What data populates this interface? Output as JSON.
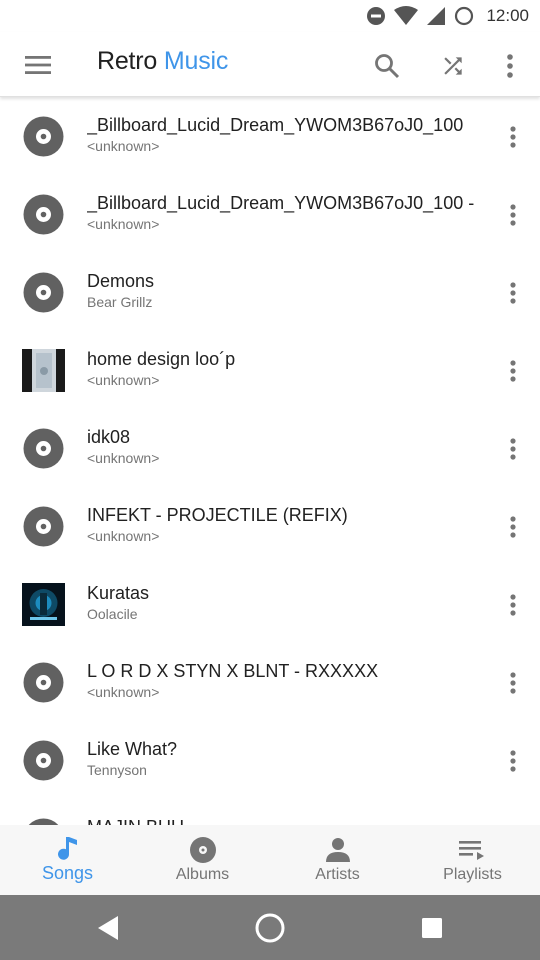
{
  "status_bar": {
    "time": "12:00"
  },
  "app": {
    "title_part1": "Retro",
    "title_part2": "Music",
    "accent_color": "#3f95e9"
  },
  "toolbar": {
    "icons": [
      "menu-icon",
      "search-icon",
      "shuffle-icon",
      "more-vert-icon"
    ]
  },
  "songs": [
    {
      "title": "_Billboard_Lucid_Dream_YWOM3B67oJ0_100",
      "artist": "<unknown>",
      "art": "disc"
    },
    {
      "title": "_Billboard_Lucid_Dream_YWOM3B67oJ0_100 -",
      "artist": "<unknown>",
      "art": "disc"
    },
    {
      "title": "Demons",
      "artist": "Bear Grillz",
      "art": "disc"
    },
    {
      "title": "home design loo´p",
      "artist": "<unknown>",
      "art": "image"
    },
    {
      "title": "idk08",
      "artist": "<unknown>",
      "art": "disc"
    },
    {
      "title": "INFEKT - PROJECTILE (REFIX)",
      "artist": "<unknown>",
      "art": "disc"
    },
    {
      "title": "Kuratas",
      "artist": "Oolacile",
      "art": "image"
    },
    {
      "title": "L O R D X STYN X BLNT - RXXXXX",
      "artist": "<unknown>",
      "art": "disc"
    },
    {
      "title": "Like What?",
      "artist": "Tennyson",
      "art": "disc"
    },
    {
      "title": "MAJIN BUU",
      "artist": "",
      "art": "disc"
    }
  ],
  "bottom_nav": [
    {
      "label": "Songs",
      "icon": "music-note-icon",
      "active": true
    },
    {
      "label": "Albums",
      "icon": "album-icon",
      "active": false
    },
    {
      "label": "Artists",
      "icon": "person-icon",
      "active": false
    },
    {
      "label": "Playlists",
      "icon": "playlist-icon",
      "active": false
    }
  ],
  "colors": {
    "accent": "#3f95e9",
    "icon_gray": "#757575",
    "disc": "#616161",
    "system_nav": "#7a7a7a"
  }
}
